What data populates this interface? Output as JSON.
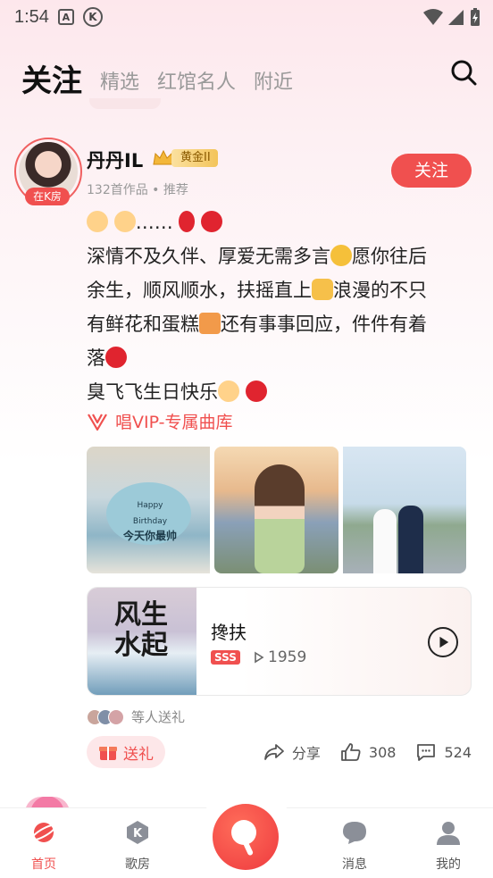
{
  "status_bar": {
    "time": "1:54",
    "icon_a": "A",
    "icon_k": "K"
  },
  "nav": {
    "active_tab": "关注",
    "tabs": [
      "精选",
      "红馆名人",
      "附近"
    ]
  },
  "post": {
    "user_name": "丹丹IL",
    "level_badge": "黄金II",
    "in_room_badge": "在K房",
    "meta": "132首作品 • 推荐",
    "follow_label": "关注",
    "text_lines": [
      "……",
      "深情不及久伴、厚爱无需多言",
      "愿你往后",
      "余生，顺风顺水，扶摇直上",
      "浪漫的不只",
      "有鲜花和蛋糕",
      "还有事事回应，件件有着",
      "落",
      "臭飞飞生日快乐"
    ],
    "vip_link": "唱VIP-专属曲库",
    "cake_text": "今天你最帅",
    "cake_top_text": "Happy Birthday",
    "song": {
      "title": "搀扶",
      "tag": "SSS",
      "plays": "1959",
      "cover_text": "风生水起"
    },
    "gifters_text": "等人送礼",
    "gift_label": "送礼",
    "share_label": "分享",
    "likes": "308",
    "comments": "524"
  },
  "bottom_nav": {
    "items": [
      "首页",
      "歌房",
      "消息",
      "我的"
    ],
    "active": "首页"
  },
  "colors": {
    "accent": "#f0504f",
    "gold": "#f3c45a"
  }
}
